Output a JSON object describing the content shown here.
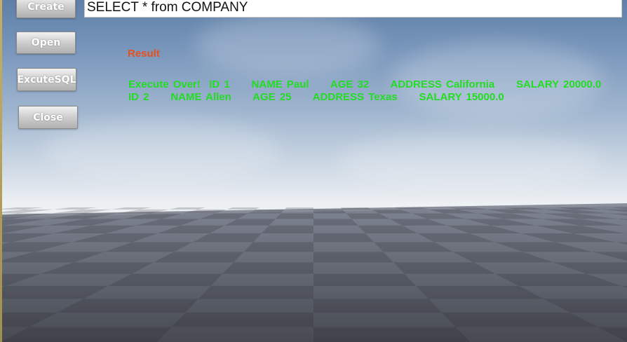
{
  "query_input": {
    "value": "SELECT * from COMPANY"
  },
  "buttons": {
    "create": "Create",
    "open": "Open",
    "execute_sql": "ExcuteSQL",
    "close": "Close"
  },
  "result": {
    "label": "Result",
    "text": "Execute Over!  ID 1     NAME Paul     AGE 32     ADDRESS California     SALARY 20000.0     ID 2     NAME Allen     AGE 25     ADDRESS Texas     SALARY 15000.0"
  },
  "colors": {
    "result_label": "#e8501c",
    "result_text": "#22dd22"
  }
}
